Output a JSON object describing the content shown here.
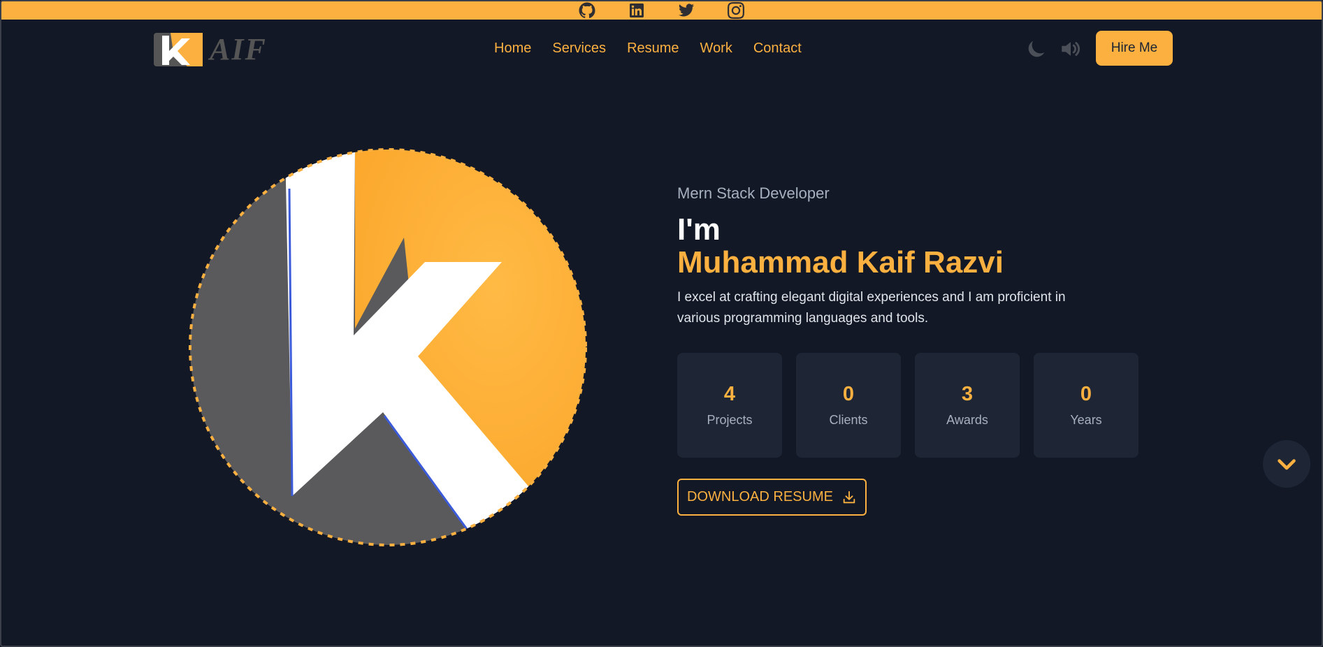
{
  "social": [
    {
      "name": "github-icon"
    },
    {
      "name": "linkedin-icon"
    },
    {
      "name": "twitter-icon"
    },
    {
      "name": "instagram-icon"
    }
  ],
  "brand": {
    "logo_text": "AIF",
    "logo_letter": "k"
  },
  "nav": {
    "links": [
      "Home",
      "Services",
      "Resume",
      "Work",
      "Contact"
    ]
  },
  "header": {
    "hire_label": "Hire Me"
  },
  "hero": {
    "role": "Mern Stack Developer",
    "greeting": "I'm",
    "name": "Muhammad Kaif Razvi",
    "description": "I excel at crafting elegant digital experiences and I am proficient in various programming languages and tools.",
    "download_label": "DOWNLOAD RESUME"
  },
  "stats": [
    {
      "value": "4",
      "label": "Projects"
    },
    {
      "value": "0",
      "label": "Clients"
    },
    {
      "value": "3",
      "label": "Awards"
    },
    {
      "value": "0",
      "label": "Years"
    }
  ],
  "colors": {
    "accent": "#fbb040",
    "background": "#121826",
    "card": "#1e2635",
    "muted_text": "#a6b0be"
  }
}
